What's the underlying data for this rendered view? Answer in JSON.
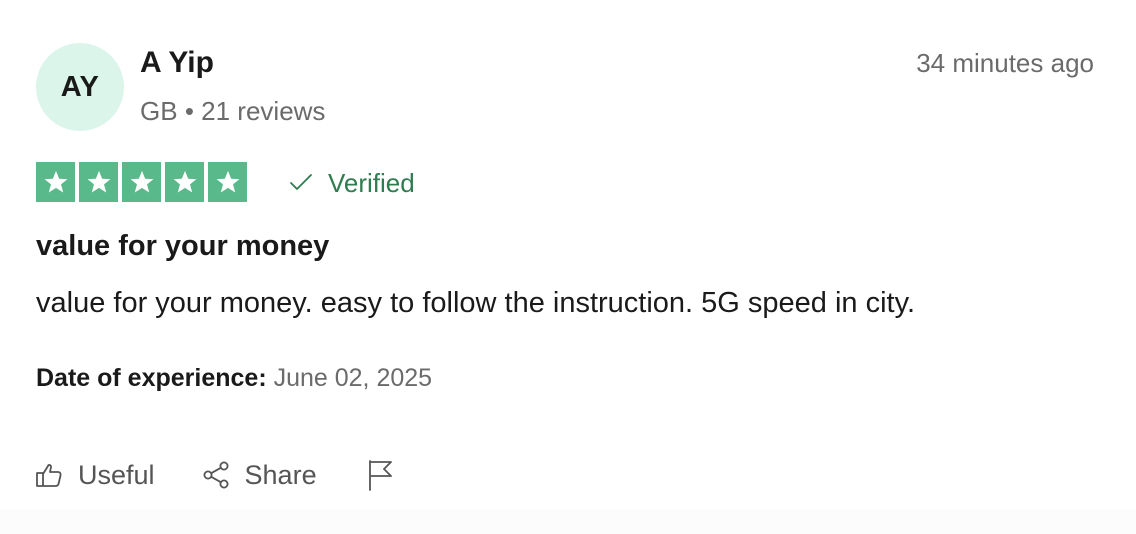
{
  "reviewer": {
    "initials": "AY",
    "name": "A Yip",
    "country": "GB",
    "separator": "•",
    "review_count": "21 reviews"
  },
  "review": {
    "timestamp": "34 minutes ago",
    "rating": 5,
    "rating_max": 5,
    "verified_label": "Verified",
    "title": "value for your money",
    "body": "value for your money. easy to follow the instruction. 5G speed in city.",
    "experience_label": "Date of experience:",
    "experience_date": "June 02, 2025"
  },
  "actions": {
    "useful_label": "Useful",
    "share_label": "Share",
    "report_icon": "flag-icon"
  },
  "colors": {
    "star_green": "#5ab98a",
    "verified_green": "#2f7d4f",
    "avatar_bg": "#dcf5ea",
    "muted_text": "#6b6b6b"
  }
}
